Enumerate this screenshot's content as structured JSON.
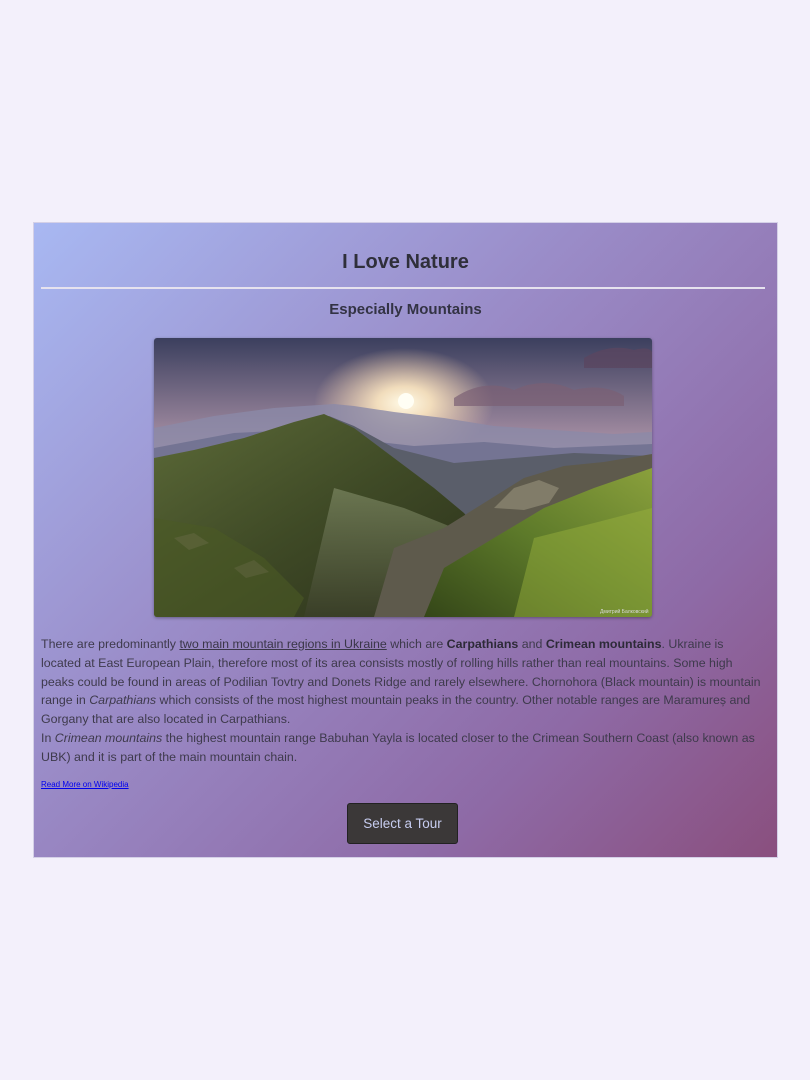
{
  "header": {
    "title": "I Love Nature",
    "subtitle": "Especially Mountains"
  },
  "image": {
    "alt": "Carpathian mountains at sunset",
    "watermark": "Дмитрий Балковский"
  },
  "article": {
    "p1_a": "There are predominantly ",
    "p1_link": "two main mountain regions in Ukraine",
    "p1_b": " which are ",
    "p1_bold1": "Carpathians",
    "p1_c": " and ",
    "p1_bold2": "Crimean mountains",
    "p1_d": ". Ukraine is located at East European Plain, therefore most of its area consists mostly of rolling hills rather than real mountains. Some high peaks could be found in areas of Podilian Tovtry and Donets Ridge and rarely elsewhere. Chornohora (Black mountain) is mountain range in ",
    "p1_italic": "Carpathians",
    "p1_e": " which consists of the most highest mountain peaks in the country. Other notable ranges are Maramureș and Gorgany that are also located in Carpathians.",
    "p2_a": "In ",
    "p2_italic": "Crimean mountains",
    "p2_b": " the highest mountain range Babuhan Yayla is located closer to the Crimean Southern Coast (also known as UBK) and it is part of the main mountain chain."
  },
  "links": {
    "wiki": "Read More on Wikipedia"
  },
  "buttons": {
    "tour": "Select a Tour"
  },
  "colors": {
    "page_bg": "#f3f0fb",
    "gradient_start": "#a8b8f2",
    "gradient_end": "#8a4f7e",
    "button_bg": "#3b3838",
    "button_text": "#c7cdf0"
  }
}
